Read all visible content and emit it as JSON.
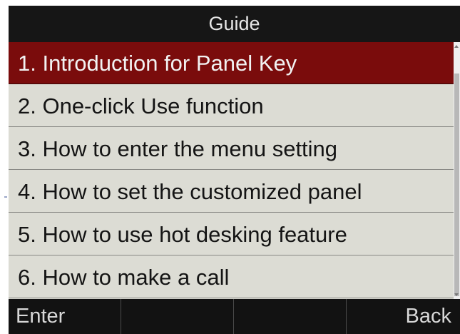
{
  "header": {
    "title": "Guide"
  },
  "menu": {
    "selected_index": 0,
    "items": [
      {
        "label": "1. Introduction for Panel Key"
      },
      {
        "label": "2. One-click Use function"
      },
      {
        "label": "3. How to enter the menu setting"
      },
      {
        "label": "4. How to set the customized panel"
      },
      {
        "label": "5. How to use hot desking feature"
      },
      {
        "label": "6. How to make a call"
      }
    ]
  },
  "softkeys": {
    "key1": "Enter",
    "key2": "",
    "key3": "",
    "key4": "Back"
  },
  "colors": {
    "selected_row": "#7a0c0c",
    "list_background": "#dcdcd4",
    "bar_background": "#161616"
  }
}
